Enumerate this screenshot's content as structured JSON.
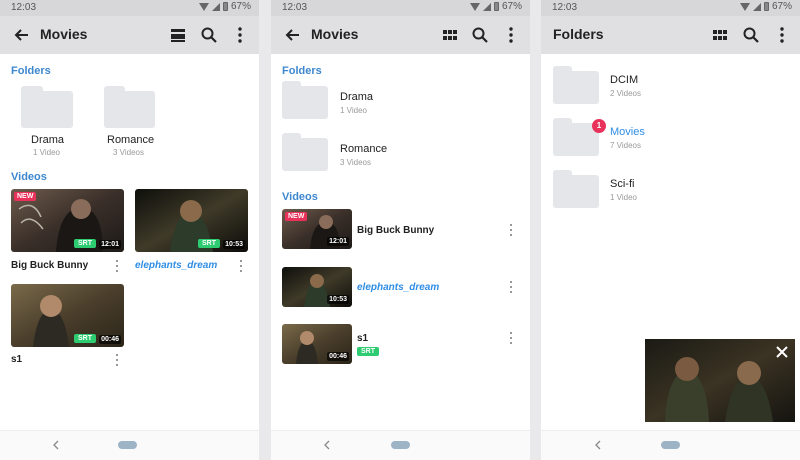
{
  "status": {
    "time": "12:03",
    "battery": "67%"
  },
  "screen1": {
    "title": "Movies",
    "folders_header": "Folders",
    "folders": [
      {
        "name": "Drama",
        "count": "1 Video"
      },
      {
        "name": "Romance",
        "count": "3 Videos"
      }
    ],
    "videos_header": "Videos",
    "videos": [
      {
        "name": "Big Buck Bunny",
        "duration": "12:01",
        "new": "NEW",
        "srt": "SRT"
      },
      {
        "name": "elephants_dream",
        "duration": "10:53",
        "srt": "SRT"
      },
      {
        "name": "s1",
        "duration": "00:46",
        "srt": "SRT"
      }
    ]
  },
  "screen2": {
    "title": "Movies",
    "folders_header": "Folders",
    "folders": [
      {
        "name": "Drama",
        "count": "1 Video"
      },
      {
        "name": "Romance",
        "count": "3 Videos"
      }
    ],
    "videos_header": "Videos",
    "videos": [
      {
        "name": "Big Buck Bunny",
        "duration": "12:01",
        "new": "NEW"
      },
      {
        "name": "elephants_dream",
        "duration": "10:53"
      },
      {
        "name": "s1",
        "duration": "00:46",
        "srt": "SRT"
      }
    ]
  },
  "screen3": {
    "title": "Folders",
    "folders": [
      {
        "name": "DCIM",
        "count": "2 Videos"
      },
      {
        "name": "Movies",
        "count": "7 Videos",
        "badge": "1"
      },
      {
        "name": "Sci-fi",
        "count": "1 Video"
      }
    ]
  },
  "icons": {
    "back": "arrow-back-icon",
    "view_list": "view-list-icon",
    "view_grid": "view-grid-icon",
    "search": "search-icon",
    "more": "more-vert-icon",
    "close": "close-icon"
  },
  "colors": {
    "accent": "#3d87cf",
    "highlight_title": "#2f8de4",
    "new_badge": "#e8325a",
    "srt_badge": "#2ecc71",
    "appbar": "#e0e0e2",
    "statusbar": "#d7d7d9"
  }
}
